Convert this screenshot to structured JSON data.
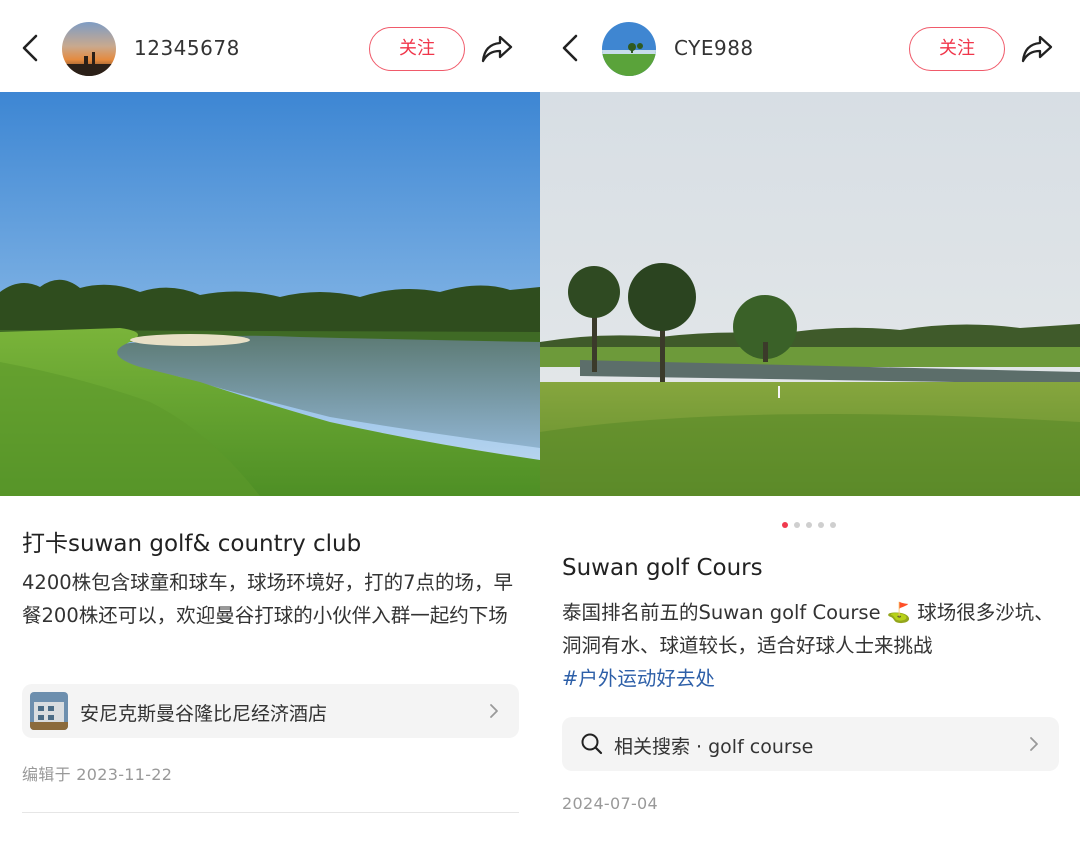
{
  "left_post": {
    "username": "12345678",
    "follow_label": "关注",
    "title": "打卡suwan golf& country club",
    "description": "4200株包含球童和球车，球场环境好，打的7点的场，早餐200株还可以，欢迎曼谷打球的小伙伴入群一起约下场",
    "location_chip": "安尼克斯曼谷隆比尼经济酒店",
    "edited_date": "编辑于 2023-11-22"
  },
  "right_post": {
    "username": "CYE988",
    "follow_label": "关注",
    "title": "Suwan golf Cours",
    "description_before": "泰国排名前五的Suwan golf Course ",
    "golf_emoji": "⛳",
    "description_after": " 球场很多沙坑、洞洞有水、球道较长，适合好球人士来挑战",
    "hashtag": "#户外运动好去处",
    "search_chip": "相关搜索 · golf course",
    "date": "2024-07-04",
    "carousel": {
      "total": 5,
      "active": 1
    }
  },
  "colors": {
    "accent": "#f0354a",
    "hashtag": "#2d5fa8",
    "meta_text": "#999999"
  },
  "icons": [
    "back-arrow-icon",
    "share-icon",
    "search-icon",
    "chevron-right-icon"
  ]
}
